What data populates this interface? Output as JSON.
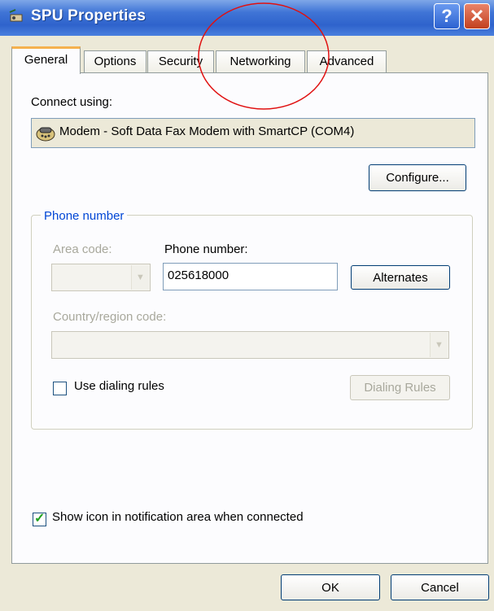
{
  "window": {
    "title": "SPU Properties",
    "help_glyph": "?",
    "close_glyph": "✕"
  },
  "tabs": [
    {
      "label": "General",
      "active": true
    },
    {
      "label": "Options",
      "active": false
    },
    {
      "label": "Security",
      "active": false
    },
    {
      "label": "Networking",
      "active": false
    },
    {
      "label": "Advanced",
      "active": false
    }
  ],
  "connect": {
    "label": "Connect using:",
    "device": "Modem - Soft Data Fax Modem with SmartCP (COM4)",
    "configure_label": "Configure..."
  },
  "phone": {
    "group_title": "Phone number",
    "area_code_label": "Area code:",
    "phone_number_label": "Phone number:",
    "phone_number_value": "025618000",
    "alternates_label": "Alternates",
    "country_label": "Country/region code:",
    "use_dialing_rules_label": "Use dialing rules",
    "use_dialing_rules_checked": false,
    "dialing_rules_label": "Dialing Rules"
  },
  "notification": {
    "label": "Show icon in notification area when connected",
    "checked": true
  },
  "footer": {
    "ok_label": "OK",
    "cancel_label": "Cancel"
  },
  "annotation": {
    "color": "#e01010"
  }
}
